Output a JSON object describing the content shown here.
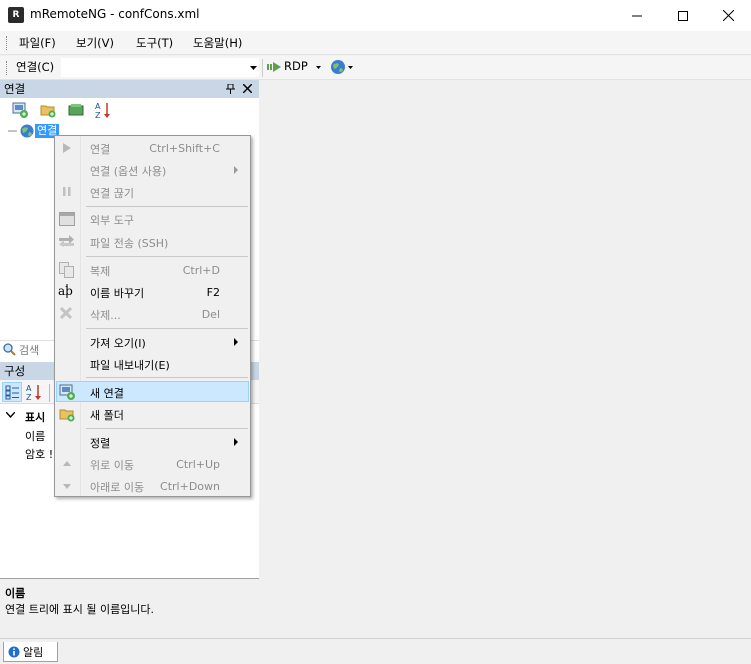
{
  "window": {
    "title": "mRemoteNG - confCons.xml",
    "icon_text": "R"
  },
  "menubar": {
    "items": [
      "파일(F)",
      "보기(V)",
      "도구(T)",
      "도움말(H)"
    ]
  },
  "toolbar": {
    "connect_label": "연결(C)",
    "protocol_label": "RDP"
  },
  "connections_panel": {
    "title": "연결",
    "tree": {
      "root_label": "연결"
    },
    "search_placeholder": "검색"
  },
  "config_panel": {
    "title": "구성",
    "group": "표시",
    "rows": [
      "이름",
      "암호 !"
    ]
  },
  "description": {
    "title": "이름",
    "text": "연결 트리에 표시 될 이름입니다."
  },
  "bottom": {
    "alert_tab": "알림"
  },
  "context_menu": {
    "connect": {
      "label": "연결",
      "shortcut": "Ctrl+Shift+C"
    },
    "connect_options": {
      "label": "연결 (옵션 사용)"
    },
    "disconnect": {
      "label": "연결 끊기"
    },
    "external_tools": {
      "label": "외부 도구"
    },
    "transfer_file": {
      "label": "파일 전송 (SSH)"
    },
    "duplicate": {
      "label": "복제",
      "shortcut": "Ctrl+D"
    },
    "rename": {
      "label": "이름 바꾸기",
      "shortcut": "F2"
    },
    "delete": {
      "label": "삭제...",
      "shortcut": "Del"
    },
    "import": {
      "label": "가져 오기(I)"
    },
    "export": {
      "label": "파일 내보내기(E)"
    },
    "new_connection": {
      "label": "새 연결"
    },
    "new_folder": {
      "label": "새 폴더"
    },
    "sort": {
      "label": "정렬"
    },
    "move_up": {
      "label": "위로 이동",
      "shortcut": "Ctrl+Up"
    },
    "move_down": {
      "label": "아래로 이동",
      "shortcut": "Ctrl+Down"
    }
  }
}
